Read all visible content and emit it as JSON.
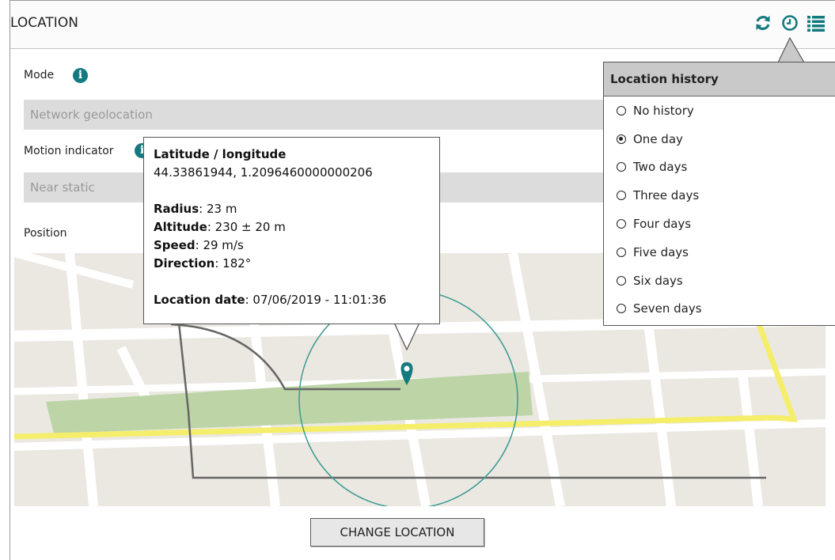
{
  "header": {
    "title": "LOCATION"
  },
  "icons": {
    "refresh": "refresh-icon",
    "history": "clock-icon",
    "list": "list-icon",
    "accent": "#137a80"
  },
  "mode": {
    "label": "Mode",
    "value": "Network geolocation"
  },
  "motion": {
    "label": "Motion indicator",
    "value": "Near static"
  },
  "position": {
    "label": "Position"
  },
  "tooltip": {
    "heading": "Latitude / longitude",
    "coords": "44.33861944, 1.2096460000000206",
    "radius_label": "Radius",
    "radius_value": ": 23 m",
    "altitude_label": "Altitude",
    "altitude_value": ": 230 ± 20 m",
    "speed_label": "Speed",
    "speed_value": ": 29 m/s",
    "direction_label": "Direction",
    "direction_value": ": 182°",
    "date_label": "Location date",
    "date_value": ":  07/06/2019 - 11:01:36"
  },
  "history": {
    "title": "Location history",
    "selected": "One day",
    "options": [
      "No history",
      "One day",
      "Two days",
      "Three days",
      "Four days",
      "Five days",
      "Six days",
      "Seven days"
    ]
  },
  "change_button": {
    "label": "CHANGE LOCATION"
  }
}
